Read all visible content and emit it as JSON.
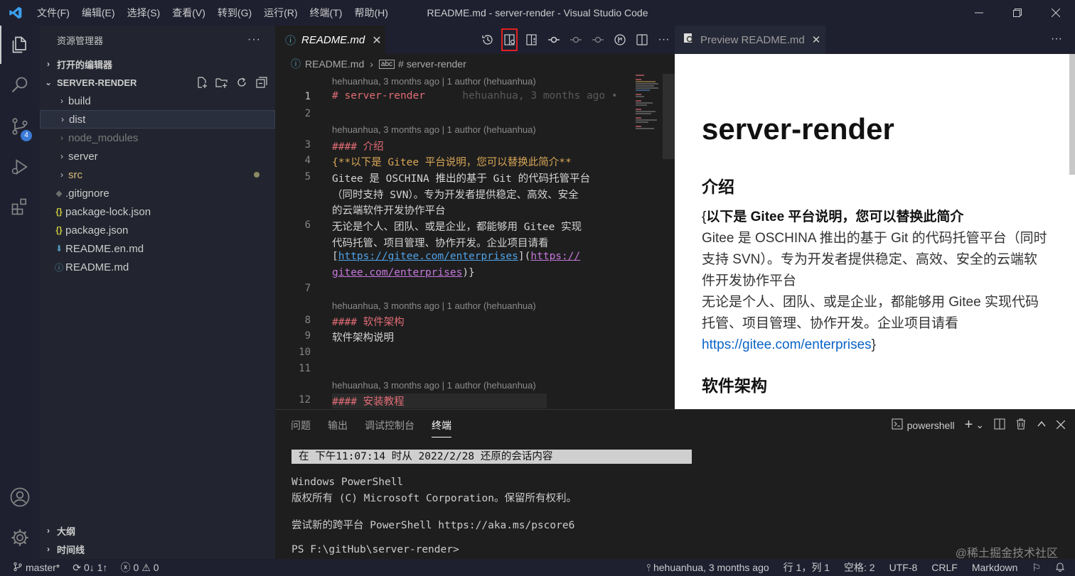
{
  "titlebar": {
    "menu": [
      "文件(F)",
      "编辑(E)",
      "选择(S)",
      "查看(V)",
      "转到(G)",
      "运行(R)",
      "终端(T)",
      "帮助(H)"
    ],
    "title": "README.md - server-render - Visual Studio Code"
  },
  "activity": {
    "scm_badge": "4"
  },
  "sidebar": {
    "header": "资源管理器",
    "open_editors": "打开的编辑器",
    "folder": "SERVER-RENDER",
    "items": [
      "build",
      "dist",
      "node_modules",
      "server",
      "src",
      ".gitignore",
      "package-lock.json",
      "package.json",
      "README.en.md",
      "README.md"
    ],
    "outline": "大纲",
    "timeline": "时间线"
  },
  "editor": {
    "tab": "README.md",
    "breadcrumb": [
      "README.md",
      "# server-render"
    ],
    "blame": "hehuanhua, 3 months ago | 1 author (hehuanhua)",
    "inline_blame": "hehuanhua, 3 months ago •",
    "line_numbers": [
      "1",
      "2",
      "3",
      "4",
      "5",
      "6",
      "7",
      "8",
      "9",
      "10",
      "11",
      "12"
    ],
    "lines": {
      "l1": "# server-render",
      "l3": "#### 介绍",
      "l4": "{**以下是 Gitee 平台说明，您可以替换此简介**",
      "l5a": "Gitee 是 OSCHINA 推出的基于 Git 的代码托管平台",
      "l5b": "（同时支持 SVN）。专为开发者提供稳定、高效、安全",
      "l5c": "的云端软件开发协作平台",
      "l6a": "无论是个人、团队、或是企业，都能够用 Gitee 实现",
      "l6b": "代码托管、项目管理、协作开发。企业项目请看",
      "l6c_link": "https://gitee.com/enterprises",
      "l6c_url": "https://",
      "l6d_url": "gitee.com/enterprises",
      "l8": "#### 软件架构",
      "l9": "软件架构说明",
      "l12": "#### 安装教程"
    }
  },
  "preview": {
    "tab": "Preview README.md",
    "h1": "server-render",
    "h2_intro": "介绍",
    "bold_line": "以下是 Gitee 平台说明，您可以替换此简介",
    "p1": "Gitee 是 OSCHINA 推出的基于 Git 的代码托管平台（同时支持 SVN）。专为开发者提供稳定、高效、安全的云端软件开发协作平台",
    "p2": "无论是个人、团队、或是企业，都能够用 Gitee 实现代码托管、项目管理、协作开发。企业项目请看",
    "link": "https://gitee.com/enterprises",
    "h2_arch": "软件架构"
  },
  "panel": {
    "tabs": [
      "问题",
      "输出",
      "调试控制台",
      "终端"
    ],
    "active_tab": "终端",
    "shell": "powershell",
    "terminal": {
      "restore": "在 下午11:07:14 时从 2022/2/28 还原的会话内容",
      "l1": "Windows PowerShell",
      "l2": "版权所有 (C) Microsoft Corporation。保留所有权利。",
      "l3": "尝试新的跨平台 PowerShell https://aka.ms/pscore6",
      "l4": "PS F:\\gitHub\\server-render>"
    }
  },
  "statusbar": {
    "branch": "master*",
    "sync": "0↓ 1↑",
    "problems": "0",
    "warnings": "0",
    "blame": "hehuanhua, 3 months ago",
    "position": "行 1，列 1",
    "spaces": "空格: 2",
    "encoding": "UTF-8",
    "eol": "CRLF",
    "language": "Markdown"
  },
  "watermark": "@稀土掘金技术社区",
  "colors": {
    "accent": "#3b7ad6",
    "highlight_box": "#e02020",
    "heading": "#e06c75"
  }
}
